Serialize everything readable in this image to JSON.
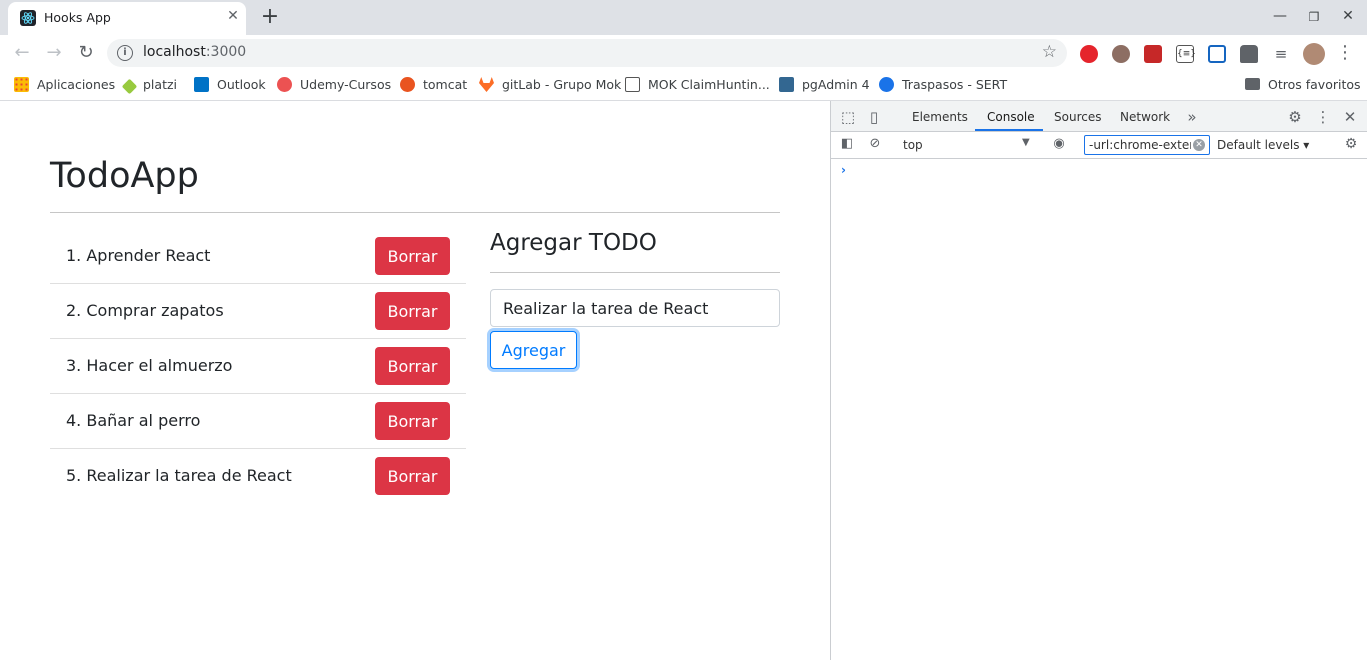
{
  "browser": {
    "tab_title": "Hooks App",
    "url_host": "localhost",
    "url_port": ":3000",
    "bookmarks": [
      {
        "label": "Aplicaciones",
        "color": "#ea4335"
      },
      {
        "label": "platzi",
        "color": "#98ca3f"
      },
      {
        "label": "Outlook",
        "color": "#0072c6"
      },
      {
        "label": "Udemy-Cursos",
        "color": "#ec5252"
      },
      {
        "label": "tomcat",
        "color": "#e95420"
      },
      {
        "label": "gitLab - Grupo Mok",
        "color": "#fc6d26"
      },
      {
        "label": "MOK ClaimHuntin...",
        "color": "#555555"
      },
      {
        "label": "pgAdmin 4",
        "color": "#336791"
      },
      {
        "label": "Traspasos - SERT",
        "color": "#1a73e8"
      },
      {
        "label": "Otros favoritos",
        "color": "#5f6368"
      }
    ]
  },
  "app": {
    "title": "TodoApp",
    "todos": [
      {
        "text": "1. Aprender React",
        "button": "Borrar"
      },
      {
        "text": "2. Comprar zapatos",
        "button": "Borrar"
      },
      {
        "text": "3. Hacer el almuerzo",
        "button": "Borrar"
      },
      {
        "text": "4. Bañar al perro",
        "button": "Borrar"
      },
      {
        "text": "5. Realizar la tarea de React",
        "button": "Borrar"
      }
    ],
    "add_title": "Agregar TODO",
    "input_value": "Realizar la tarea de React",
    "add_button": "Agregar",
    "colors": {
      "danger": "#dc3545",
      "primary": "#007bff"
    }
  },
  "devtools": {
    "tabs": [
      "Elements",
      "Console",
      "Sources",
      "Network"
    ],
    "active_tab": "Console",
    "context": "top",
    "filter_value": "-url:chrome-extens",
    "levels": "Default levels",
    "prompt": "›"
  }
}
